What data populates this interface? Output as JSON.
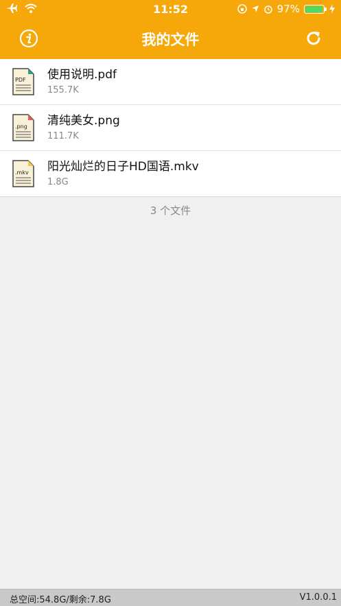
{
  "status_bar": {
    "time": "11:52",
    "battery": "97%",
    "battery_level": 0.97
  },
  "nav": {
    "title": "我的文件",
    "info_icon": "info-icon",
    "refresh_icon": "refresh-icon"
  },
  "files": [
    {
      "name": "使用说明.pdf",
      "size": "155.7K",
      "badge": "PDF",
      "icon": "pdf-file-icon"
    },
    {
      "name": "清纯美女.png",
      "size": "111.7K",
      "badge": ".png",
      "icon": "png-file-icon"
    },
    {
      "name": "阳光灿烂的日子HD国语.mkv",
      "size": "1.8G",
      "badge": ".mkv",
      "icon": "mkv-file-icon"
    }
  ],
  "file_count": "3 个文件",
  "footer": {
    "storage": "总空间:54.8G/剩余:7.8G",
    "version": "V1.0.0.1"
  },
  "colors": {
    "accent": "#f6a80a",
    "battery_green": "#4cd964",
    "pdf_corner": "#2a9d8f",
    "png_corner": "#e05d5d",
    "mkv_corner": "#f2c94c"
  }
}
